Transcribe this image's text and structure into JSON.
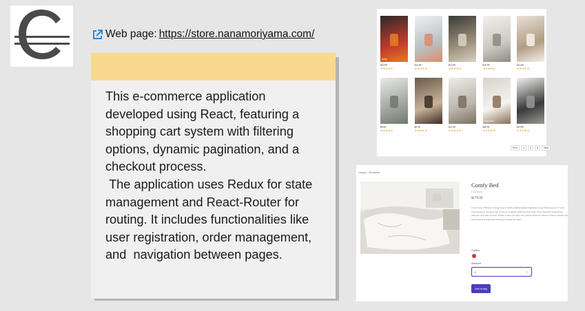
{
  "weblink": {
    "label": "Web page: ",
    "url": "https://store.nanamoriyama.com/"
  },
  "description": "This e-commerce application developed using React, featuring a shopping cart system with filtering options, dynamic pagination, and a checkout process.\n The application uses Redux for state management and React-Router for routing. It includes functionalities like user registration, order management, and  navigation between pages.",
  "colors": {
    "band": "#f8d98f",
    "accent_button": "#4a3fb7",
    "link_icon": "#2b8ad8",
    "stars": "#e0a32e"
  },
  "product_grid": {
    "items": [
      {
        "label": "lamp",
        "price": "$19.99",
        "stars": "★★★★★",
        "icon": "lantern-photo"
      },
      {
        "label": "",
        "price": "$12.99",
        "stars": "★★★★★",
        "icon": "chair-photo"
      },
      {
        "label": "",
        "price": "$15.99",
        "stars": "★★★★★",
        "icon": "dining-photo"
      },
      {
        "label": "",
        "price": "$19.99",
        "stars": "★★★★★",
        "icon": "bedroom-photo"
      },
      {
        "label": "",
        "price": "$15.99",
        "stars": "★★★★★",
        "icon": "stairs-photo"
      },
      {
        "label": "",
        "price": "$9.99",
        "stars": "★★★★★",
        "icon": "bed-photo"
      },
      {
        "label": "",
        "price": "$9.99",
        "stars": "★★★★★",
        "icon": "bookshelf-photo"
      },
      {
        "label": "",
        "price": "$13.99",
        "stars": "★★★★★",
        "icon": "table-photo"
      },
      {
        "label": "King Bed",
        "price": "$49.99",
        "stars": "★★★★★",
        "icon": "kingbed-photo"
      },
      {
        "label": "",
        "price": "$19.99",
        "stars": "★★★★★",
        "icon": "lounge-chair-photo"
      }
    ],
    "pagination": [
      "Prev",
      "1",
      "2",
      "3",
      "Next"
    ]
  },
  "product_detail": {
    "breadcrumb": "Home  ›  Products",
    "title": "Comfy Bed",
    "company": "Comfora",
    "price": "$179.99",
    "body": "Cloud bread VHS hell of banjo bicycle rights jianbing umami mumblecore etsy 8-bit pok pok +1 wolf. Vexillologist yr dreamcatcher waistcoat, authentic chillwave trust fund. Viral typewriter fingerstache pinterest pork belly narwhal. Schlitz venmo everyday carry kitsch pitchfork chillwave iPhone taiyaki trust fund hashtag kinfolk microdosing gochujang live-edge",
    "colors_label": "Colors",
    "amount_label": "Amount",
    "amount_value": "1",
    "add_button": "Add to bag"
  }
}
